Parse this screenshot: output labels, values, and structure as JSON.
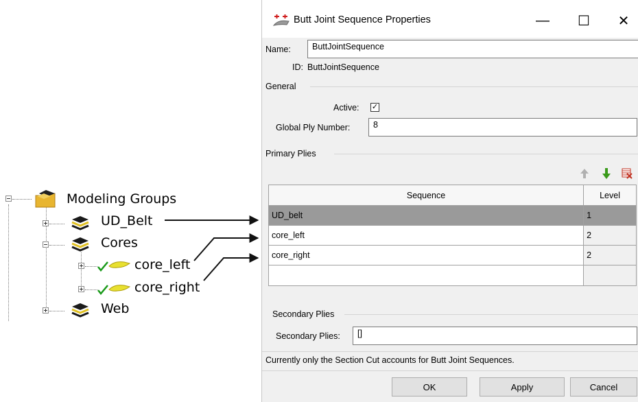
{
  "tree": {
    "root": "Modeling Groups",
    "items": [
      {
        "label": "UD_Belt"
      },
      {
        "label": "Cores"
      },
      {
        "label": "core_left"
      },
      {
        "label": "core_right"
      },
      {
        "label": "Web"
      }
    ]
  },
  "dialog": {
    "title": "Butt Joint Sequence Properties",
    "window_controls": {
      "minimize": "—",
      "maximize": "☐",
      "close": "✕"
    },
    "name_label": "Name:",
    "name_value": "ButtJointSequence",
    "id_label": "ID:",
    "id_value": "ButtJointSequence",
    "general": {
      "title": "General",
      "active_label": "Active:",
      "active_checked": true,
      "active_glyph": "✓",
      "global_ply_label": "Global Ply Number:",
      "global_ply_value": "8"
    },
    "primary": {
      "title": "Primary Plies",
      "col_sequence": "Sequence",
      "col_level": "Level",
      "rows": [
        {
          "sequence": "UD_belt",
          "level": "1",
          "selected": true
        },
        {
          "sequence": "core_left",
          "level": "2"
        },
        {
          "sequence": "core_right",
          "level": "2"
        },
        {
          "sequence": "",
          "level": ""
        }
      ]
    },
    "secondary": {
      "title": "Secondary Plies",
      "label": "Secondary Plies:",
      "value": "[]"
    },
    "info": "Currently only the Section Cut accounts for Butt Joint Sequences.",
    "buttons": {
      "ok": "OK",
      "apply": "Apply",
      "cancel": "Cancel"
    }
  },
  "colors": {
    "selected_row": "#9a9a9a",
    "arrow_up": "#b0b0b0",
    "arrow_down": "#3a9a1a",
    "delete": "#c03020"
  }
}
